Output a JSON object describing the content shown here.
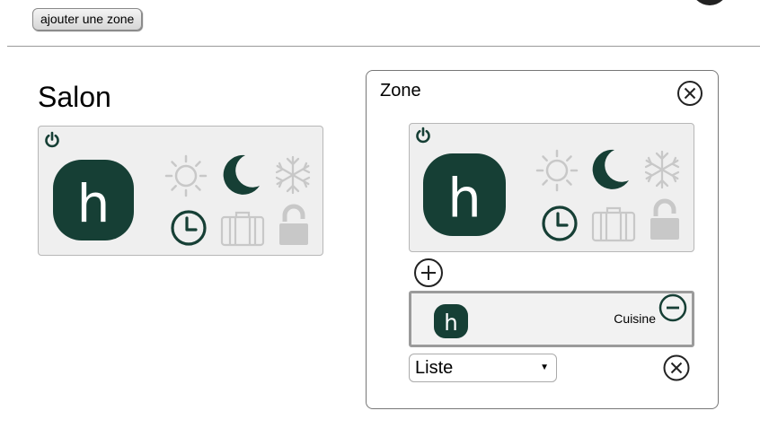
{
  "toolbar": {
    "add_zone_label": "ajouter une zone"
  },
  "zone": {
    "title": "Salon",
    "device": {
      "power_icon": "power-icon",
      "logo_letter": "h",
      "modes": [
        "sun-icon",
        "moon-icon",
        "snowflake-icon",
        "clock-icon",
        "suitcase-icon",
        "unlocked-padlock-icon"
      ],
      "active_modes": [
        "moon-icon",
        "clock-icon"
      ]
    }
  },
  "panel": {
    "title": "Zone",
    "device": {
      "logo_letter": "h"
    },
    "members": [
      {
        "name": "Cuisine",
        "logo_letter": "h"
      }
    ],
    "list_select": {
      "selected": "Liste"
    }
  },
  "colors": {
    "brand": "#163f35",
    "inactive": "#c8c8c8",
    "card_bg": "#efefef"
  }
}
